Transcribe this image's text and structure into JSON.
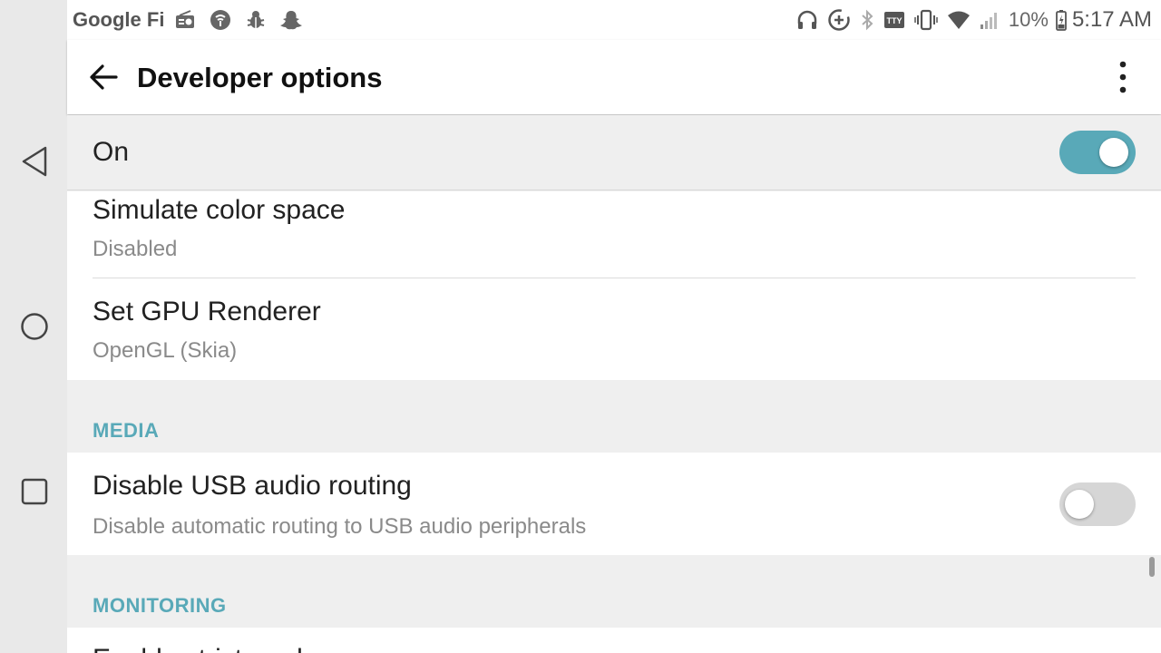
{
  "status_bar": {
    "carrier": "Google Fi",
    "left_icons": [
      "radio-icon",
      "wifi-calling-icon",
      "bug-icon",
      "snapchat-icon"
    ],
    "right_icons": [
      "headphones-icon",
      "data-saver-icon",
      "bluetooth-icon",
      "tty-icon",
      "vibrate-icon",
      "wifi-icon",
      "signal-icon"
    ],
    "battery_percent": "10%",
    "time": "5:17 AM"
  },
  "app_bar": {
    "title": "Developer options"
  },
  "master_switch": {
    "label": "On",
    "state": "on",
    "accent_color": "#59a9b8"
  },
  "settings": {
    "simulate_color_space": {
      "title": "Simulate color space",
      "summary": "Disabled"
    },
    "gpu_renderer": {
      "title": "Set GPU Renderer",
      "summary": "OpenGL (Skia)"
    },
    "media_header": "MEDIA",
    "disable_usb_audio": {
      "title": "Disable USB audio routing",
      "summary": "Disable automatic routing to USB audio peripherals",
      "state": "off"
    },
    "monitoring_header": "MONITORING",
    "next_item_partial": {
      "title": "Enable strict mode"
    }
  }
}
